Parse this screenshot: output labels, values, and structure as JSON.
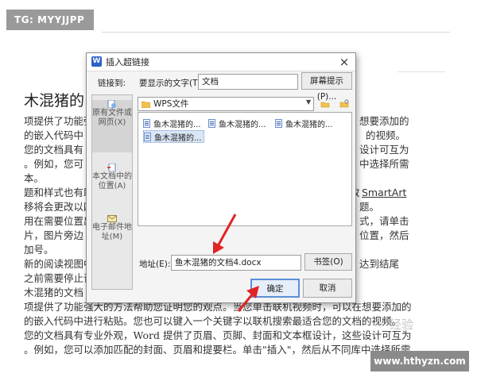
{
  "watermark": {
    "top_left": "TG: MYYJJPP",
    "bottom_right": "www.hthyzn.com",
    "faint": "经验"
  },
  "document": {
    "title": "木混猪的",
    "lines": [
      "项提供了功能强",
      "的嵌入代码中",
      "您的文档具有",
      "。例如，您可",
      "本。",
      "题和样式也有助",
      "移将会更改以四",
      "用在需要位置出",
      "片，图片旁边",
      "加号。",
      "新的阅读视图中",
      "之前需要停止读",
      "木混猪的文档",
      "项提供了功能强大的方法帮助您证明您的观点。当您单击联机视频时，可以在想要添加的",
      "的嵌入代码中进行粘贴。您也可以键入一个关键字以联机搜索最适合您的文档的视频。",
      "您的文档具有专业外观，Word 提供了页眉、页脚、封面和文本框设计，这些设计可互为",
      "。例如，您可以添加匹配的封面、页眉和提要栏。单击\"插入\"，然后从不同库中选择所需"
    ],
    "right_fragments": [
      "想要添加的",
      "的视频。",
      "设计可互为",
      "中选择所需",
      "SmartArt",
      "题。",
      "式，请单击",
      "位置，然后",
      "达到结尾"
    ],
    "smartart_prefix": "改"
  },
  "dialog": {
    "title": "插入超链接",
    "close_glyph": "×",
    "link_to_label": "链接到:",
    "display_text_label": "要显示的文字(T):",
    "display_text_value": "文档",
    "screen_tip_button": "屏幕提示(P)...",
    "folder_value": "WPS文件",
    "side_items": [
      {
        "label": "原有文件或网页(X)"
      },
      {
        "label": "本文档中的位置(A)"
      },
      {
        "label": "电子邮件地址(M)"
      }
    ],
    "files": [
      "鱼木混猪的...",
      "鱼木混猪的...",
      "鱼木混猪的...",
      "鱼木混猪的..."
    ],
    "address_label": "地址(E):",
    "address_value": "鱼木混猪的文档4.docx",
    "bookmark_button": "书签(O)",
    "ok_button": "确定",
    "cancel_button": "取消"
  },
  "colors": {
    "accent": "#2b62c7",
    "arrow": "#e02424",
    "ok_border": "#5b8fd6"
  }
}
